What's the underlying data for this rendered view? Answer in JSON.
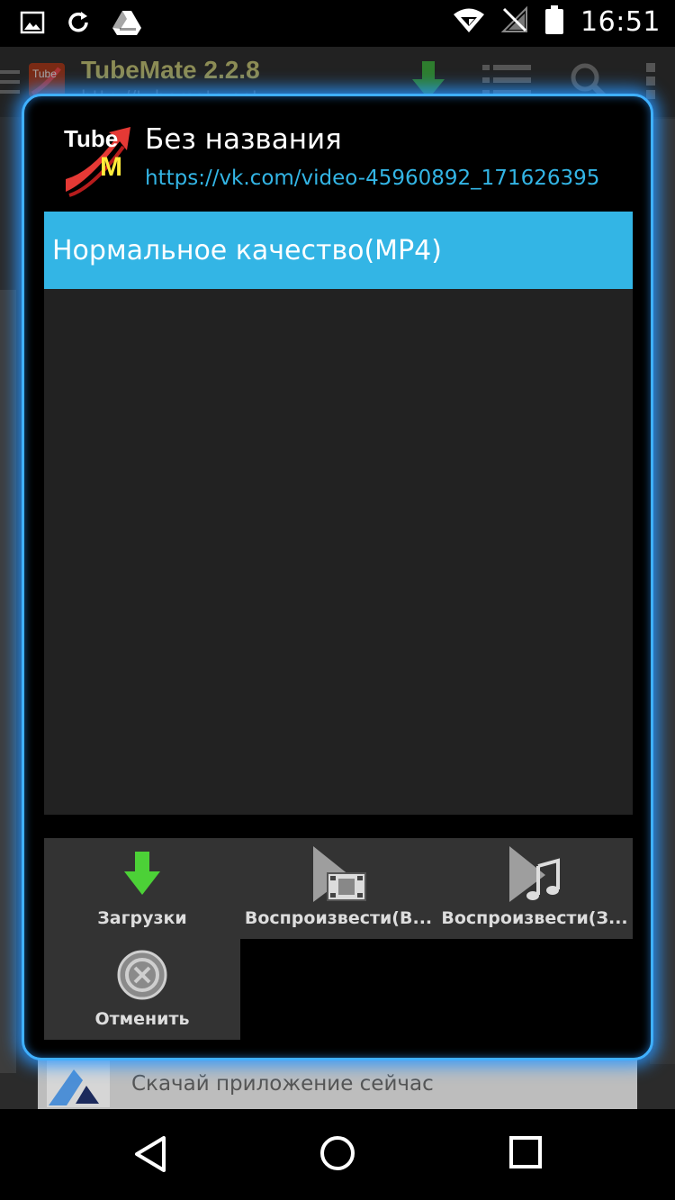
{
  "status_bar": {
    "time": "16:51",
    "left_icons": [
      "image-icon",
      "refresh-icon",
      "drive-icon"
    ],
    "right_icons": [
      "wifi-icon",
      "no-signal-icon",
      "battery-icon"
    ]
  },
  "background_app": {
    "title": "TubeMate 2.2.8",
    "url": "http://tubemate.net",
    "ad_text": "Скачай приложение сейчас"
  },
  "dialog": {
    "title": "Без названия",
    "url": "https://vk.com/video-45960892_171626395",
    "qualities": [
      {
        "label": "Нормальное качество(MP4)",
        "selected": true
      }
    ],
    "actions": [
      {
        "label": "Загрузки",
        "icon": "download-arrow-icon"
      },
      {
        "label": "Воспроизвести(В...",
        "icon": "play-video-icon"
      },
      {
        "label": "Воспроизвести(З...",
        "icon": "play-music-icon"
      },
      {
        "label": "Отменить",
        "icon": "cancel-icon"
      }
    ]
  },
  "nav_bar": {
    "icons": [
      "back-icon",
      "home-icon",
      "recents-icon"
    ]
  },
  "colors": {
    "accent": "#33b5e5",
    "dialog_glow": "#3fb0ff",
    "download_green": "#4cd137"
  }
}
